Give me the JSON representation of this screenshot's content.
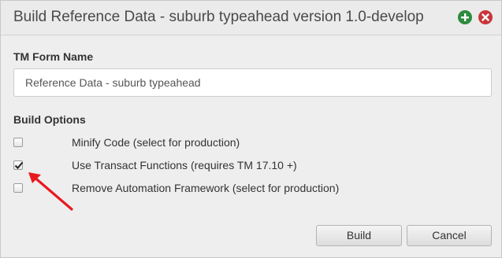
{
  "dialog": {
    "title": "Build Reference Data - suburb typeahead version 1.0-develop",
    "icons": {
      "add": "plus-circle-icon",
      "close": "close-circle-icon"
    },
    "colors": {
      "add": "#2e8b3e",
      "close": "#c9353a",
      "annotation": "#e8191e"
    }
  },
  "form": {
    "name_label": "TM Form Name",
    "name_value": "Reference Data - suburb typeahead"
  },
  "build_options": {
    "heading": "Build Options",
    "items": [
      {
        "label": "Minify Code (select for production)",
        "checked": false
      },
      {
        "label": "Use Transact Functions (requires TM 17.10 +)",
        "checked": true
      },
      {
        "label": "Remove Automation Framework (select for production)",
        "checked": false
      }
    ]
  },
  "buttons": {
    "build": "Build",
    "cancel": "Cancel"
  }
}
